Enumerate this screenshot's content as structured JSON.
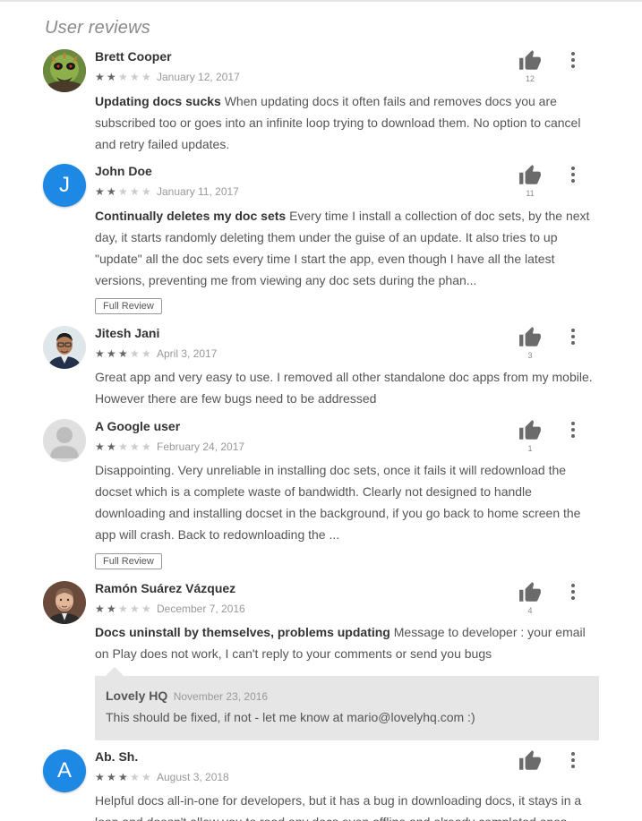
{
  "section_title": "User reviews",
  "reviews": [
    {
      "author": "Brett Cooper",
      "rating": 2,
      "date": "January 12, 2017",
      "title": "Updating docs sucks",
      "text": "When updating docs it often fails and removes docs you are subscribed too or goes into an infinite loop trying to download them. No option to cancel and retry failed updates.",
      "helpful": "12"
    },
    {
      "author": "John Doe",
      "avatar_letter": "J",
      "rating": 2,
      "date": "January 11, 2017",
      "title": "Continually deletes my doc sets",
      "text": "Every time I install a collection of doc sets, by the next day, it starts randomly deleting them under the guise of an update. It also tries to up \"update\" all the doc sets every time I start the app, even though I have all the latest versions, preventing me from viewing any doc sets during the phan...",
      "helpful": "11",
      "full_review_label": "Full Review"
    },
    {
      "author": "Jitesh Jani",
      "rating": 3,
      "date": "April 3, 2017",
      "title": "",
      "text": "Great app and very easy to use. I removed all other standalone doc apps from my mobile. However there are few bugs need to be addressed",
      "helpful": "3"
    },
    {
      "author": "A Google user",
      "rating": 2,
      "date": "February 24, 2017",
      "title": "",
      "text": "Disappointing. Very unreliable in installing doc sets, once it fails it will redownload the docset which is a complete waste of bandwidth. Clearly not designed to handle downloading and installing docset in the background, if you go back to home screen the app will crash. Back to redownloading the ...",
      "helpful": "1",
      "full_review_label": "Full Review"
    },
    {
      "author": "Ramón Suárez Vázquez",
      "rating": 2,
      "date": "December 7, 2016",
      "title": "Docs uninstall by themselves, problems updating",
      "text": "Message to developer : your email on Play does not work, I can't reply to your comments or send you bugs",
      "helpful": "4",
      "reply": {
        "author": "Lovely HQ",
        "date": "November 23, 2016",
        "text": "This should be fixed, if not - let me know at mario@lovelyhq.com :)"
      }
    },
    {
      "author": "Ab. Sh.",
      "avatar_letter": "A",
      "rating": 3,
      "date": "August 3, 2018",
      "title": "",
      "text": "Helpful docs all-in-one for developers, but it has a bug in downloading docs, it stays in a loop and doesn't allow you to read any docs even offline and already completed ones. Seems it"
    }
  ],
  "colors": {
    "avatar_blue": "#1e88e5",
    "reply_bg": "#e6e6e6",
    "star_on": "#666666",
    "star_off": "#cccccc"
  },
  "icons": {
    "helpful": "thumb-up-icon",
    "menu": "more-vert-icon",
    "star": "star-icon"
  }
}
